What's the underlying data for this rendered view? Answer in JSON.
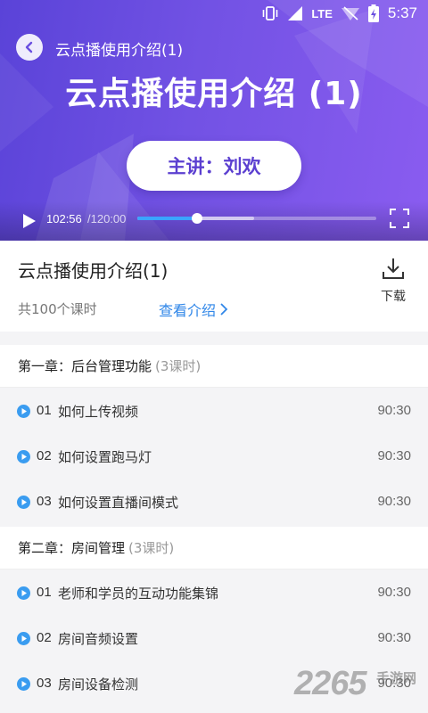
{
  "status_bar": {
    "network": "LTE",
    "time": "5:37"
  },
  "player": {
    "top_title": "云点播使用介绍(1)",
    "slide_title": "云点播使用介绍 (1)",
    "speaker": "主讲：刘欢",
    "current_time": "102:56",
    "total_time": "/120:00",
    "played_fraction": 0.25,
    "buffered_fraction": 0.49,
    "accent": "#3aa4ff"
  },
  "course": {
    "title": "云点播使用介绍(1)",
    "lesson_count": "共100个课时",
    "view_intro": "查看介绍",
    "download_label": "下载"
  },
  "chapters": [
    {
      "title": "第一章：后台管理功能",
      "hours": "(3课时)",
      "lessons": [
        {
          "num": "01",
          "name": "如何上传视频",
          "duration": "90:30"
        },
        {
          "num": "02",
          "name": "如何设置跑马灯",
          "duration": "90:30"
        },
        {
          "num": "03",
          "name": "如何设置直播间模式",
          "duration": "90:30"
        }
      ]
    },
    {
      "title": "第二章：房间管理",
      "hours": "(3课时)",
      "lessons": [
        {
          "num": "01",
          "name": "老师和学员的互动功能集锦",
          "duration": "90:30"
        },
        {
          "num": "02",
          "name": "房间音频设置",
          "duration": "90:30"
        },
        {
          "num": "03",
          "name": "房间设备检测",
          "duration": "90:30"
        }
      ]
    }
  ],
  "watermark": {
    "number": "2265",
    "text": "手游网"
  }
}
